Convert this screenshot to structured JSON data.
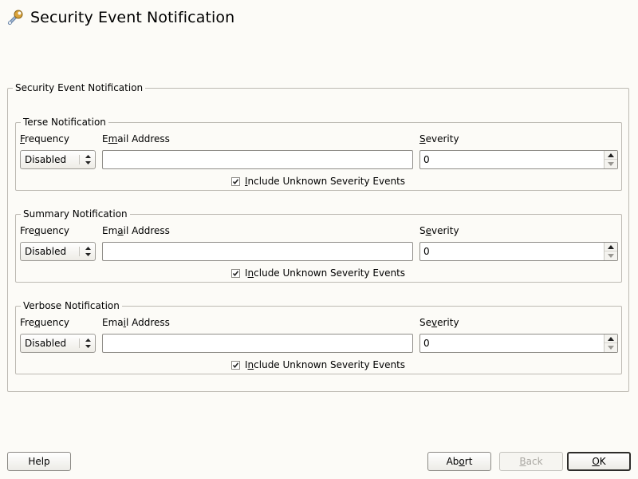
{
  "window": {
    "title": "Security Event Notification",
    "icon": "wrench-icon"
  },
  "outer_group": {
    "legend": "Security Event Notification"
  },
  "labels": {
    "frequency": "Frequency",
    "email": "Email Address",
    "severity": "Severity",
    "include_unknown": "Include Unknown Severity Events"
  },
  "groups": [
    {
      "legend": "Terse Notification",
      "frequency": "Disabled",
      "email": "",
      "severity": "0",
      "include_unknown": true
    },
    {
      "legend": "Summary Notification",
      "frequency": "Disabled",
      "email": "",
      "severity": "0",
      "include_unknown": true
    },
    {
      "legend": "Verbose Notification",
      "frequency": "Disabled",
      "email": "",
      "severity": "0",
      "include_unknown": true
    }
  ],
  "buttons": {
    "help": "Help",
    "abort": "Abort",
    "back": "Back",
    "ok": "OK"
  }
}
